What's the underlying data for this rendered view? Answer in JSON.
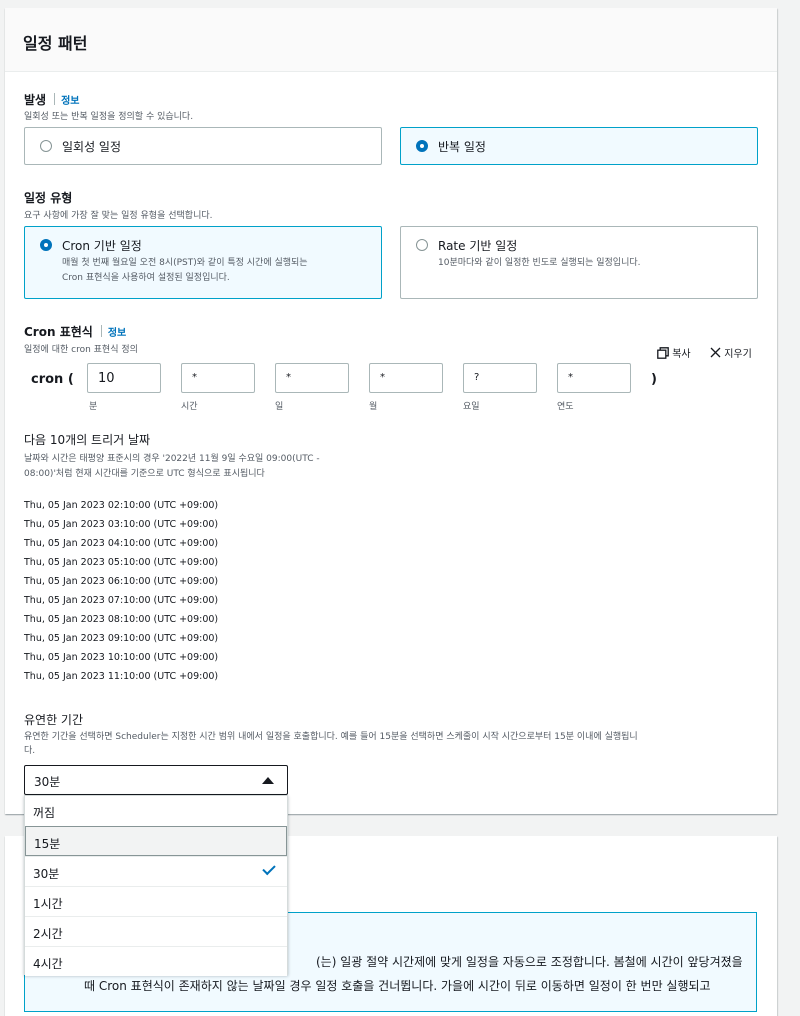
{
  "panel": {
    "title": "일정 패턴"
  },
  "occurrence": {
    "label": "발생",
    "info": "정보",
    "description": "일회성 또는 반복 일정을 정의할 수 있습니다.",
    "options": [
      {
        "label": "일회성 일정",
        "selected": false
      },
      {
        "label": "반복 일정",
        "selected": true
      }
    ]
  },
  "schedule_type": {
    "label": "일정 유형",
    "description": "요구 사항에 가장 잘 맞는 일정 유형을 선택합니다.",
    "options": [
      {
        "label": "Cron 기반 일정",
        "description_line1": "매월 첫 번째 월요일 오전 8시(PST)와 같이 특정 시간에 실행되는",
        "description_line2": "Cron 표현식을 사용하여 설정된 일정입니다.",
        "selected": true
      },
      {
        "label": "Rate 기반 일정",
        "description_line1": "10분마다와 같이 일정한 빈도로 실행되는 일정입니다.",
        "selected": false
      }
    ]
  },
  "cron": {
    "label": "Cron 표현식",
    "info": "정보",
    "description": "일정에 대한 cron 표현식 정의",
    "copy_label": "복사",
    "clear_label": "지우기",
    "prefix": "cron (",
    "suffix": ")",
    "fields": [
      {
        "value": "10",
        "caption": "분"
      },
      {
        "value": "*",
        "caption": "시간"
      },
      {
        "value": "*",
        "caption": "일"
      },
      {
        "value": "*",
        "caption": "월"
      },
      {
        "value": "?",
        "caption": "요일"
      },
      {
        "value": "*",
        "caption": "연도"
      }
    ]
  },
  "triggers": {
    "title": "다음 10개의 트리거 날짜",
    "description_line1": "날짜와 시간은 태평양 표준시의 경우 '2022년 11월 9일 수요일 09:00(UTC -",
    "description_line2": "08:00)'처럼 현재 시간대를 기준으로 UTC 형식으로 표시됩니다",
    "dates": [
      "Thu, 05 Jan 2023 02:10:00 (UTC +09:00)",
      "Thu, 05 Jan 2023 03:10:00 (UTC +09:00)",
      "Thu, 05 Jan 2023 04:10:00 (UTC +09:00)",
      "Thu, 05 Jan 2023 05:10:00 (UTC +09:00)",
      "Thu, 05 Jan 2023 06:10:00 (UTC +09:00)",
      "Thu, 05 Jan 2023 07:10:00 (UTC +09:00)",
      "Thu, 05 Jan 2023 08:10:00 (UTC +09:00)",
      "Thu, 05 Jan 2023 09:10:00 (UTC +09:00)",
      "Thu, 05 Jan 2023 10:10:00 (UTC +09:00)",
      "Thu, 05 Jan 2023 11:10:00 (UTC +09:00)"
    ]
  },
  "flexible_window": {
    "label": "유연한 기간",
    "description_line1": "유연한 기간을 선택하면 Scheduler는 지정한 시간 범위 내에서 일정을 호출합니다. 예를 들어 15분을 선택하면 스케줄이 시작 시간으로부터 15분 이내에 실행됩니",
    "description_line2": "다.",
    "selected": "30분",
    "options": [
      {
        "label": "꺼짐"
      },
      {
        "label": "15분",
        "highlighted": true
      },
      {
        "label": "30분",
        "checked": true
      },
      {
        "label": "1시간"
      },
      {
        "label": "2시간"
      },
      {
        "label": "4시간"
      }
    ]
  },
  "dst_notice": {
    "line1": "(는) 일광 절약 시간제에 맞게 일정을 자동으로 조정합니다. 봄철에 시간이 앞당겨졌을",
    "line2": "때 Cron 표현식이 존재하지 않는 날짜일 경우 일정 호출을 건너뜁니다. 가을에 시간이 뒤로 이동하면 일정이 한 번만 실행되고"
  },
  "colors": {
    "accent": "#0073bb",
    "selected_border": "#00a1c9",
    "selected_bg": "#f1faff"
  }
}
